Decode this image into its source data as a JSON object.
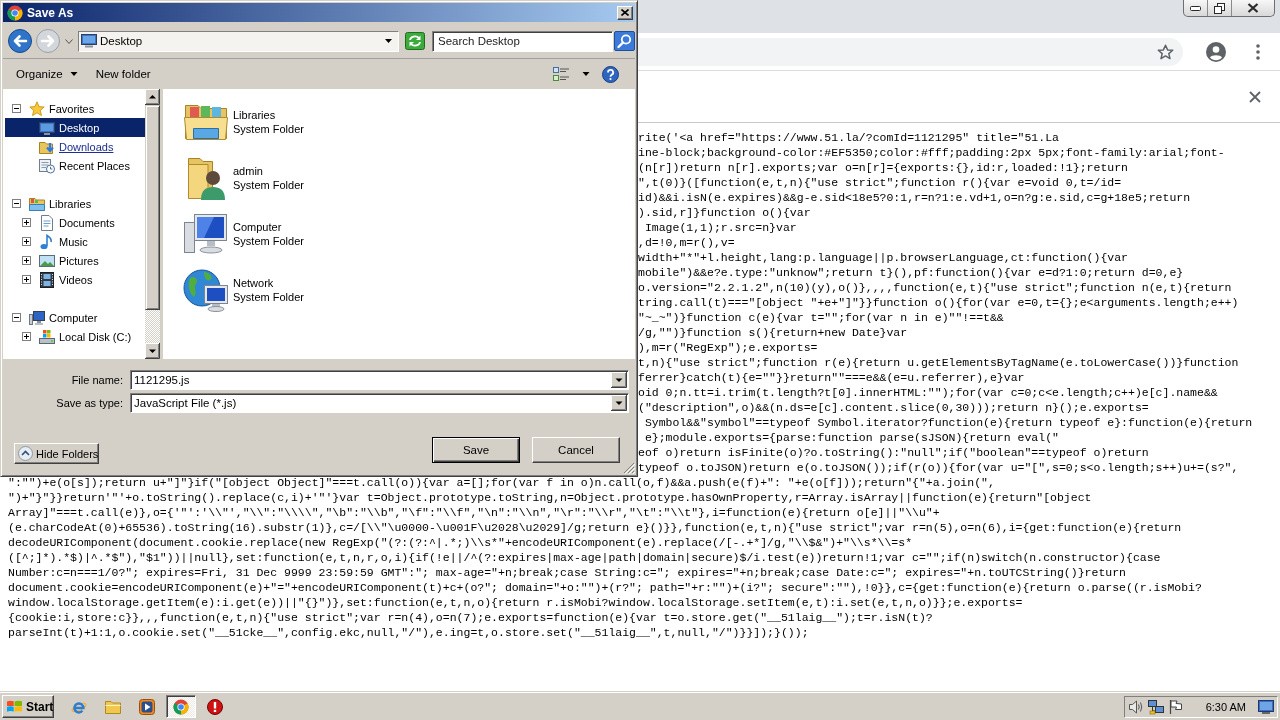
{
  "dialog": {
    "title": "Save As",
    "history": [
      {
        "kind": "back",
        "disabled": false
      },
      {
        "kind": "forward",
        "disabled": true
      }
    ],
    "location": "Desktop",
    "search": {
      "placeholder": "Search Desktop"
    },
    "commands": [
      {
        "label": "Organize",
        "kind": "menu"
      },
      {
        "label": "New folder",
        "kind": "button"
      }
    ],
    "tree": [
      {
        "label": "Favorites",
        "kind": "favorites",
        "expanded": true,
        "selected": false,
        "hovered": false,
        "children": [
          {
            "label": "Desktop",
            "kind": "desktop",
            "selected": true,
            "hovered": false
          },
          {
            "label": "Downloads",
            "kind": "downloads",
            "selected": false,
            "hovered": true
          },
          {
            "label": "Recent Places",
            "kind": "recent",
            "selected": false,
            "hovered": false
          }
        ]
      },
      {
        "label": "Libraries",
        "kind": "libraries",
        "expanded": true,
        "selected": false,
        "hovered": false,
        "children": [
          {
            "label": "Documents",
            "kind": "documents",
            "expanded": false,
            "selected": false,
            "hovered": false
          },
          {
            "label": "Music",
            "kind": "music",
            "expanded": false,
            "selected": false,
            "hovered": false
          },
          {
            "label": "Pictures",
            "kind": "pictures",
            "expanded": false,
            "selected": false,
            "hovered": false
          },
          {
            "label": "Videos",
            "kind": "videos",
            "expanded": false,
            "selected": false,
            "hovered": false
          }
        ]
      },
      {
        "label": "Computer",
        "kind": "computer",
        "expanded": true,
        "selected": false,
        "hovered": false,
        "children": [
          {
            "label": "Local Disk (C:)",
            "kind": "disk",
            "expanded": false,
            "selected": false,
            "hovered": false
          }
        ]
      }
    ],
    "items": [
      {
        "name": "Libraries",
        "type": "System Folder",
        "kind": "libraries"
      },
      {
        "name": "admin",
        "type": "System Folder",
        "kind": "user"
      },
      {
        "name": "Computer",
        "type": "System Folder",
        "kind": "computer"
      },
      {
        "name": "Network",
        "type": "System Folder",
        "kind": "network"
      }
    ],
    "file_name": {
      "label": "File name:",
      "value": "1121295.js"
    },
    "save_as_type": {
      "label": "Save as type:",
      "value": "JavaScript File (*.js)"
    },
    "hide_folders": "Hide Folders",
    "buttons": [
      {
        "label": "Save",
        "default": true
      },
      {
        "label": "Cancel",
        "default": false
      }
    ]
  },
  "browser": {
    "code_lines": [
      "rite('<a href=\"https://www.51.la/?comId=1121295\" title=\"51.La",
      "ine-block;background-color:#EF5350;color:#fff;padding:2px 5px;font-family:arial;font-",
      "(n[r])return n[r].exports;var o=n[r]={exports:{},id:r,loaded:!1};return",
      "\",t(0)}([function(e,t,n){\"use strict\";function r(){var e=void 0,t=/id=",
      "id)&&i.isN(e.expires)&&g-e.sid<18e5?0:1,r=n?1:e.vd+1,o=n?g:e.sid,c=g+18e5;return",
      ").sid,r]}function o(){var",
      " Image(1,1);r.src=n}var",
      ",d=!0,m=r(),v=",
      "width+\"*\"+l.height,lang:p.language||p.browserLanguage,ct:function(){var",
      "mobile\")&&e?e.type:\"unknow\";return t}(),pf:function(){var e=d?1:0;return d=0,e}",
      "o.version=\"2.2.1.2\",n(10)(y),o()},,,,function(e,t){\"use strict\";function n(e,t){return",
      "tring.call(t)===\"[object \"+e+\"]\"}}function o(){for(var e=0,t={};e<arguments.length;e++)",
      "\"~_~\")}function c(e){var t=\"\";for(var n in e)\"\"!==t&&",
      "/g,\"\")}function s(){return+new Date}var",
      "),m=r(\"RegExp\");e.exports=",
      "t,n){\"use strict\";function r(e){return u.getElementsByTagName(e.toLowerCase())}function",
      "ferrer}catch(t){e=\"\"}}return\"\"===e&&(e=u.referrer),e}var",
      "oid 0;n.tt=i.trim(t.length?t[0].innerHTML:\"\");for(var c=0;c<e.length;c++)e[c].name&&",
      "(\"description\",o)&&(n.ds=e[c].content.slice(0,30)));return n}();e.exports=",
      " Symbol&&\"symbol\"==typeof Symbol.iterator?function(e){return typeof e}:function(e){return",
      " e};module.exports={parse:function parse(sJSON){return eval(\"",
      "eof o)return isFinite(o)?o.toString():\"null\";if(\"boolean\"==typeof o)return",
      "typeof o.toJSON)return e(o.toJSON());if(r(o)){for(var u=\"[\",s=0;s<o.length;s++)u+=(s?\",",
      "\":\"\")+e(o[s]);return u+\"]\"}if(\"[object Object]\"===t.call(o)){var a=[];for(var f in o)n.call(o,f)&&a.push(e(f)+\": \"+e(o[f]));return\"{\"+a.join(\",",
      "\")+\"}\"}}return'\"'+o.toString().replace(c,i)+'\"'}var t=Object.prototype.toString,n=Object.prototype.hasOwnProperty,r=Array.isArray||function(e){return\"[object",
      "Array]\"===t.call(e)},o={'\"':'\\\\\"',\"\\\\\":\"\\\\\\\\\",\"\\b\":\"\\\\b\",\"\\f\":\"\\\\f\",\"\\n\":\"\\\\n\",\"\\r\":\"\\\\r\",\"\\t\":\"\\\\t\"},i=function(e){return o[e]||\"\\\\u\"+",
      "(e.charCodeAt(0)+65536).toString(16).substr(1)},c=/[\\\\\"\\u0000-\\u001F\\u2028\\u2029]/g;return e}()}},function(e,t,n){\"use strict\";var r=n(5),o=n(6),i={get:function(e){return",
      "decodeURIComponent(document.cookie.replace(new RegExp(\"(?:(?:^|.*;)\\\\s*\"+encodeURIComponent(e).replace(/[-.+*]/g,\"\\\\$&\")+\"\\\\s*\\\\=s*",
      "([^;]*).*$)|^.*$\"),\"$1\"))||null},set:function(e,t,n,r,o,i){if(!e||/^(?:expires|max-age|path|domain|secure)$/i.test(e))return!1;var c=\"\";if(n)switch(n.constructor){case",
      "Number:c=n===1/0?\"; expires=Fri, 31 Dec 9999 23:59:59 GMT\":\"; max-age=\"+n;break;case String:c=\"; expires=\"+n;break;case Date:c=\"; expires=\"+n.toUTCString()}return",
      "document.cookie=encodeURIComponent(e)+\"=\"+encodeURIComponent(t)+c+(o?\"; domain=\"+o:\"\")+(r?\"; path=\"+r:\"\")+(i?\"; secure\":\"\"),!0}},c={get:function(e){return o.parse((r.isMobi?",
      "window.localStorage.getItem(e):i.get(e))||\"{}\")},set:function(e,t,n,o){return r.isMobi?window.localStorage.setItem(e,t):i.set(e,t,n,o)}};e.exports=",
      "{cookie:i,store:c}},,,function(e,t,n){\"use strict\";var r=n(4),o=n(7);e.exports=function(e){var t=o.store.get(\"__51laig__\");t=r.isN(t)?",
      "parseInt(t)+1:1,o.cookie.set(\"__51cke__\",config.ekc,null,\"/\"),e.ing=t,o.store.set(\"__51laig__\",t,null,\"/\")}}]);}());"
    ]
  },
  "taskbar": {
    "start": "Start",
    "apps": [
      {
        "kind": "e_logo",
        "selected": false
      },
      {
        "kind": "folder",
        "selected": false
      },
      {
        "kind": "player",
        "selected": false
      },
      {
        "kind": "ring_logo",
        "selected": true
      },
      {
        "kind": "alert",
        "selected": false
      }
    ],
    "clock": "6:30 AM"
  }
}
